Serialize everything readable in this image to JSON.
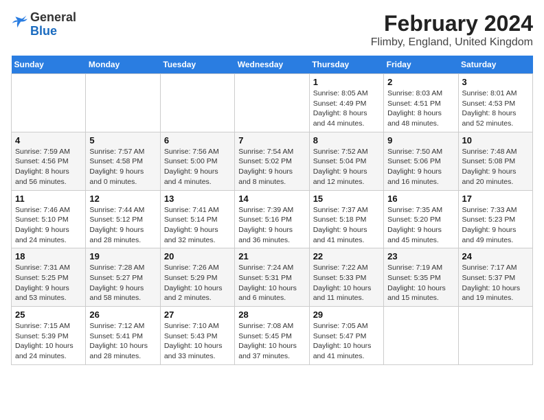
{
  "logo": {
    "text_general": "General",
    "text_blue": "Blue"
  },
  "header": {
    "title": "February 2024",
    "subtitle": "Flimby, England, United Kingdom"
  },
  "weekdays": [
    "Sunday",
    "Monday",
    "Tuesday",
    "Wednesday",
    "Thursday",
    "Friday",
    "Saturday"
  ],
  "weeks": [
    [
      {
        "day": "",
        "info": ""
      },
      {
        "day": "",
        "info": ""
      },
      {
        "day": "",
        "info": ""
      },
      {
        "day": "",
        "info": ""
      },
      {
        "day": "1",
        "info": "Sunrise: 8:05 AM\nSunset: 4:49 PM\nDaylight: 8 hours\nand 44 minutes."
      },
      {
        "day": "2",
        "info": "Sunrise: 8:03 AM\nSunset: 4:51 PM\nDaylight: 8 hours\nand 48 minutes."
      },
      {
        "day": "3",
        "info": "Sunrise: 8:01 AM\nSunset: 4:53 PM\nDaylight: 8 hours\nand 52 minutes."
      }
    ],
    [
      {
        "day": "4",
        "info": "Sunrise: 7:59 AM\nSunset: 4:56 PM\nDaylight: 8 hours\nand 56 minutes."
      },
      {
        "day": "5",
        "info": "Sunrise: 7:57 AM\nSunset: 4:58 PM\nDaylight: 9 hours\nand 0 minutes."
      },
      {
        "day": "6",
        "info": "Sunrise: 7:56 AM\nSunset: 5:00 PM\nDaylight: 9 hours\nand 4 minutes."
      },
      {
        "day": "7",
        "info": "Sunrise: 7:54 AM\nSunset: 5:02 PM\nDaylight: 9 hours\nand 8 minutes."
      },
      {
        "day": "8",
        "info": "Sunrise: 7:52 AM\nSunset: 5:04 PM\nDaylight: 9 hours\nand 12 minutes."
      },
      {
        "day": "9",
        "info": "Sunrise: 7:50 AM\nSunset: 5:06 PM\nDaylight: 9 hours\nand 16 minutes."
      },
      {
        "day": "10",
        "info": "Sunrise: 7:48 AM\nSunset: 5:08 PM\nDaylight: 9 hours\nand 20 minutes."
      }
    ],
    [
      {
        "day": "11",
        "info": "Sunrise: 7:46 AM\nSunset: 5:10 PM\nDaylight: 9 hours\nand 24 minutes."
      },
      {
        "day": "12",
        "info": "Sunrise: 7:44 AM\nSunset: 5:12 PM\nDaylight: 9 hours\nand 28 minutes."
      },
      {
        "day": "13",
        "info": "Sunrise: 7:41 AM\nSunset: 5:14 PM\nDaylight: 9 hours\nand 32 minutes."
      },
      {
        "day": "14",
        "info": "Sunrise: 7:39 AM\nSunset: 5:16 PM\nDaylight: 9 hours\nand 36 minutes."
      },
      {
        "day": "15",
        "info": "Sunrise: 7:37 AM\nSunset: 5:18 PM\nDaylight: 9 hours\nand 41 minutes."
      },
      {
        "day": "16",
        "info": "Sunrise: 7:35 AM\nSunset: 5:20 PM\nDaylight: 9 hours\nand 45 minutes."
      },
      {
        "day": "17",
        "info": "Sunrise: 7:33 AM\nSunset: 5:23 PM\nDaylight: 9 hours\nand 49 minutes."
      }
    ],
    [
      {
        "day": "18",
        "info": "Sunrise: 7:31 AM\nSunset: 5:25 PM\nDaylight: 9 hours\nand 53 minutes."
      },
      {
        "day": "19",
        "info": "Sunrise: 7:28 AM\nSunset: 5:27 PM\nDaylight: 9 hours\nand 58 minutes."
      },
      {
        "day": "20",
        "info": "Sunrise: 7:26 AM\nSunset: 5:29 PM\nDaylight: 10 hours\nand 2 minutes."
      },
      {
        "day": "21",
        "info": "Sunrise: 7:24 AM\nSunset: 5:31 PM\nDaylight: 10 hours\nand 6 minutes."
      },
      {
        "day": "22",
        "info": "Sunrise: 7:22 AM\nSunset: 5:33 PM\nDaylight: 10 hours\nand 11 minutes."
      },
      {
        "day": "23",
        "info": "Sunrise: 7:19 AM\nSunset: 5:35 PM\nDaylight: 10 hours\nand 15 minutes."
      },
      {
        "day": "24",
        "info": "Sunrise: 7:17 AM\nSunset: 5:37 PM\nDaylight: 10 hours\nand 19 minutes."
      }
    ],
    [
      {
        "day": "25",
        "info": "Sunrise: 7:15 AM\nSunset: 5:39 PM\nDaylight: 10 hours\nand 24 minutes."
      },
      {
        "day": "26",
        "info": "Sunrise: 7:12 AM\nSunset: 5:41 PM\nDaylight: 10 hours\nand 28 minutes."
      },
      {
        "day": "27",
        "info": "Sunrise: 7:10 AM\nSunset: 5:43 PM\nDaylight: 10 hours\nand 33 minutes."
      },
      {
        "day": "28",
        "info": "Sunrise: 7:08 AM\nSunset: 5:45 PM\nDaylight: 10 hours\nand 37 minutes."
      },
      {
        "day": "29",
        "info": "Sunrise: 7:05 AM\nSunset: 5:47 PM\nDaylight: 10 hours\nand 41 minutes."
      },
      {
        "day": "",
        "info": ""
      },
      {
        "day": "",
        "info": ""
      }
    ]
  ]
}
